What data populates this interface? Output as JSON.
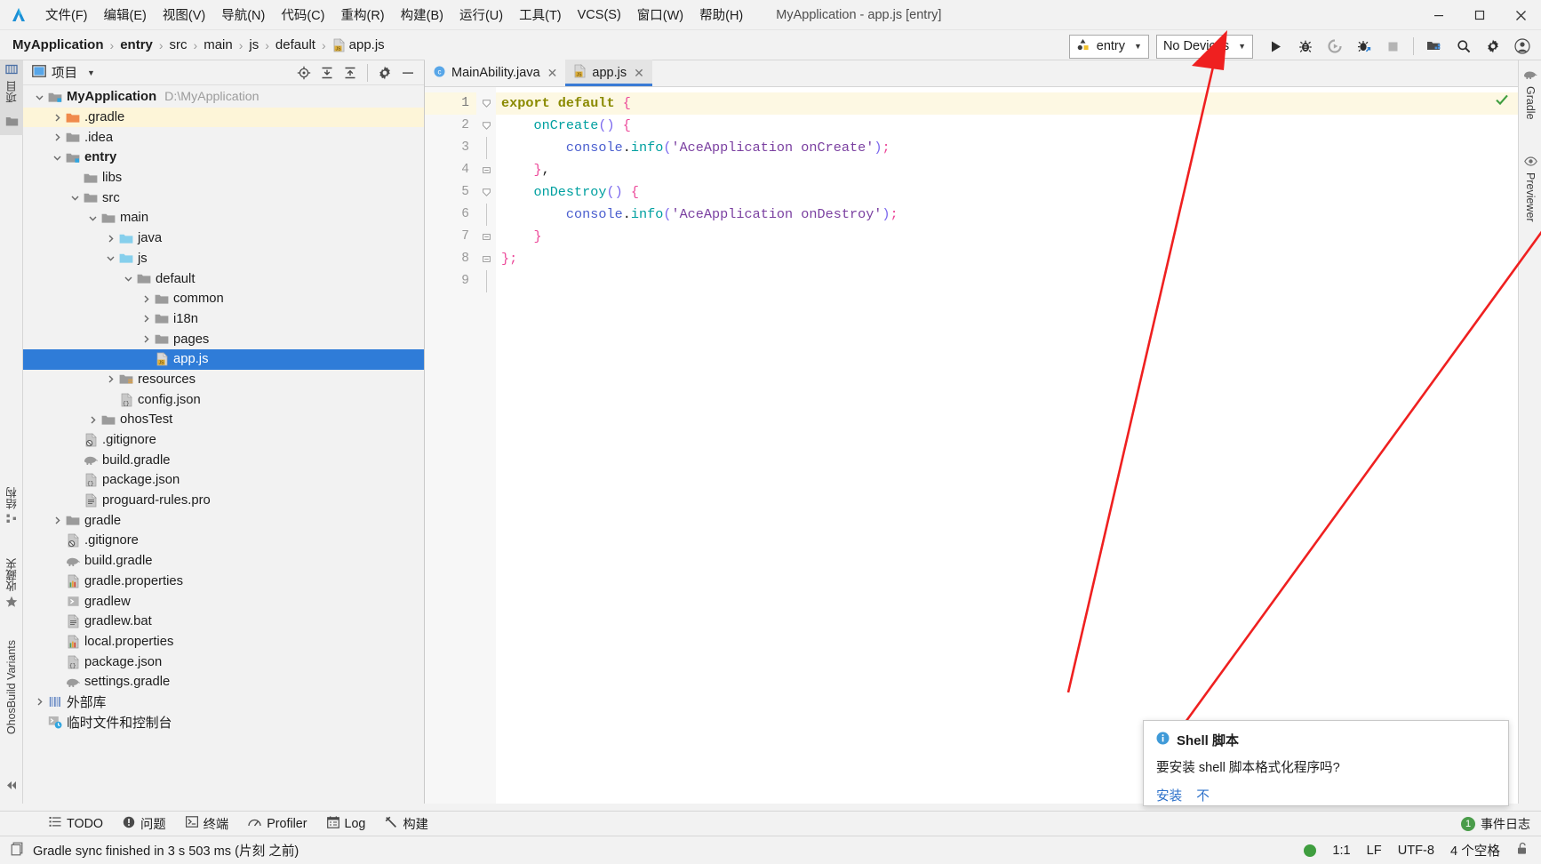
{
  "window": {
    "title": "MyApplication - app.js [entry]",
    "logo_icon": "deveco-logo-icon",
    "minimize_icon": "minimize-icon",
    "maximize_icon": "maximize-icon",
    "close_icon": "close-icon"
  },
  "menubar": {
    "items": [
      {
        "label": "文件(F)"
      },
      {
        "label": "编辑(E)"
      },
      {
        "label": "视图(V)"
      },
      {
        "label": "导航(N)"
      },
      {
        "label": "代码(C)"
      },
      {
        "label": "重构(R)"
      },
      {
        "label": "构建(B)"
      },
      {
        "label": "运行(U)"
      },
      {
        "label": "工具(T)"
      },
      {
        "label": "VCS(S)"
      },
      {
        "label": "窗口(W)"
      },
      {
        "label": "帮助(H)"
      }
    ]
  },
  "breadcrumb": {
    "items": [
      {
        "label": "MyApplication",
        "bold": true
      },
      {
        "label": "entry",
        "bold": true
      },
      {
        "label": "src",
        "bold": false
      },
      {
        "label": "main",
        "bold": false
      },
      {
        "label": "js",
        "bold": false
      },
      {
        "label": "default",
        "bold": false
      },
      {
        "label": "app.js",
        "bold": false,
        "icon": "js-file-icon"
      }
    ],
    "separator": "›"
  },
  "toolbar": {
    "module_selector": {
      "label": "entry",
      "icon": "module-icon",
      "caret": "▼"
    },
    "device_selector": {
      "label": "No Devices",
      "caret": "▼"
    },
    "buttons": [
      {
        "name": "run-button",
        "icon": "play-icon"
      },
      {
        "name": "debug-button",
        "icon": "bug-icon"
      },
      {
        "name": "attach-debugger-button",
        "icon": "attach-debug-icon",
        "disabled": true
      },
      {
        "name": "profile-button",
        "icon": "bug-profile-icon"
      },
      {
        "name": "stop-button",
        "icon": "stop-square-icon",
        "disabled": true
      },
      {
        "name": "project-structure-button",
        "icon": "project-structure-icon"
      },
      {
        "name": "search-everywhere-button",
        "icon": "search-icon"
      },
      {
        "name": "settings-button",
        "icon": "gear-icon"
      },
      {
        "name": "account-button",
        "icon": "account-icon"
      }
    ]
  },
  "left_rail": {
    "top": [
      {
        "label": "项目",
        "icon": "project-tool-icon",
        "active": true
      },
      {
        "label": "",
        "icon": "folder-icon",
        "active": false
      }
    ],
    "bottom": [
      {
        "label": "结构",
        "icon": "structure-icon"
      },
      {
        "label": "收藏夹",
        "icon": "star-icon"
      },
      {
        "label": "OhosBuild Variants",
        "icon": "variants-icon"
      }
    ],
    "collapse_icon": "collapse-all-icon"
  },
  "right_rail": {
    "items": [
      {
        "label": "Gradle",
        "icon": "gradle-elephant-icon"
      },
      {
        "label": "Previewer",
        "icon": "eye-icon"
      }
    ]
  },
  "project_panel": {
    "header": {
      "title": "项目",
      "title_icon": "project-window-icon",
      "dropdown_caret": "▼",
      "actions": [
        {
          "name": "locate-file-icon"
        },
        {
          "name": "expand-all-icon"
        },
        {
          "name": "collapse-all-icon"
        },
        {
          "name": "gear-icon"
        },
        {
          "name": "hide-icon"
        }
      ]
    },
    "tree": [
      {
        "depth": 0,
        "arrow": "down",
        "icon": "module-folder-icon",
        "label": "MyApplication",
        "bold": true,
        "path": "D:\\MyApplication",
        "state": "normal"
      },
      {
        "depth": 1,
        "arrow": "right",
        "icon": "folder-orange-icon",
        "label": ".gradle",
        "bold": false,
        "path": "",
        "state": "highlight"
      },
      {
        "depth": 1,
        "arrow": "right",
        "icon": "folder-icon",
        "label": ".idea",
        "bold": false,
        "path": "",
        "state": "normal"
      },
      {
        "depth": 1,
        "arrow": "down",
        "icon": "module-folder-icon",
        "label": "entry",
        "bold": true,
        "path": "",
        "state": "normal"
      },
      {
        "depth": 2,
        "arrow": "none",
        "icon": "folder-icon",
        "label": "libs",
        "bold": false,
        "path": "",
        "state": "normal"
      },
      {
        "depth": 2,
        "arrow": "down",
        "icon": "folder-icon",
        "label": "src",
        "bold": false,
        "path": "",
        "state": "normal"
      },
      {
        "depth": 3,
        "arrow": "down",
        "icon": "folder-icon",
        "label": "main",
        "bold": false,
        "path": "",
        "state": "normal"
      },
      {
        "depth": 4,
        "arrow": "right",
        "icon": "folder-blue-icon",
        "label": "java",
        "bold": false,
        "path": "",
        "state": "normal"
      },
      {
        "depth": 4,
        "arrow": "down",
        "icon": "folder-blue-icon",
        "label": "js",
        "bold": false,
        "path": "",
        "state": "normal"
      },
      {
        "depth": 5,
        "arrow": "down",
        "icon": "folder-icon",
        "label": "default",
        "bold": false,
        "path": "",
        "state": "normal"
      },
      {
        "depth": 6,
        "arrow": "right",
        "icon": "folder-icon",
        "label": "common",
        "bold": false,
        "path": "",
        "state": "normal"
      },
      {
        "depth": 6,
        "arrow": "right",
        "icon": "folder-icon",
        "label": "i18n",
        "bold": false,
        "path": "",
        "state": "normal"
      },
      {
        "depth": 6,
        "arrow": "right",
        "icon": "folder-icon",
        "label": "pages",
        "bold": false,
        "path": "",
        "state": "normal"
      },
      {
        "depth": 6,
        "arrow": "none",
        "icon": "js-file-icon",
        "label": "app.js",
        "bold": false,
        "path": "",
        "state": "selected"
      },
      {
        "depth": 4,
        "arrow": "right",
        "icon": "resources-folder-icon",
        "label": "resources",
        "bold": false,
        "path": "",
        "state": "normal"
      },
      {
        "depth": 4,
        "arrow": "none",
        "icon": "json-file-icon",
        "label": "config.json",
        "bold": false,
        "path": "",
        "state": "normal"
      },
      {
        "depth": 3,
        "arrow": "right",
        "icon": "folder-icon",
        "label": "ohosTest",
        "bold": false,
        "path": "",
        "state": "normal"
      },
      {
        "depth": 2,
        "arrow": "none",
        "icon": "gitignore-file-icon",
        "label": ".gitignore",
        "bold": false,
        "path": "",
        "state": "normal"
      },
      {
        "depth": 2,
        "arrow": "none",
        "icon": "gradle-file-icon",
        "label": "build.gradle",
        "bold": false,
        "path": "",
        "state": "normal"
      },
      {
        "depth": 2,
        "arrow": "none",
        "icon": "json-file-icon",
        "label": "package.json",
        "bold": false,
        "path": "",
        "state": "normal"
      },
      {
        "depth": 2,
        "arrow": "none",
        "icon": "text-file-icon",
        "label": "proguard-rules.pro",
        "bold": false,
        "path": "",
        "state": "normal"
      },
      {
        "depth": 1,
        "arrow": "right",
        "icon": "folder-icon",
        "label": "gradle",
        "bold": false,
        "path": "",
        "state": "normal"
      },
      {
        "depth": 1,
        "arrow": "none",
        "icon": "gitignore-file-icon",
        "label": ".gitignore",
        "bold": false,
        "path": "",
        "state": "normal"
      },
      {
        "depth": 1,
        "arrow": "none",
        "icon": "gradle-file-icon",
        "label": "build.gradle",
        "bold": false,
        "path": "",
        "state": "normal"
      },
      {
        "depth": 1,
        "arrow": "none",
        "icon": "properties-file-icon",
        "label": "gradle.properties",
        "bold": false,
        "path": "",
        "state": "normal"
      },
      {
        "depth": 1,
        "arrow": "none",
        "icon": "script-file-icon",
        "label": "gradlew",
        "bold": false,
        "path": "",
        "state": "normal"
      },
      {
        "depth": 1,
        "arrow": "none",
        "icon": "text-file-icon",
        "label": "gradlew.bat",
        "bold": false,
        "path": "",
        "state": "normal"
      },
      {
        "depth": 1,
        "arrow": "none",
        "icon": "properties-file-icon",
        "label": "local.properties",
        "bold": false,
        "path": "",
        "state": "normal"
      },
      {
        "depth": 1,
        "arrow": "none",
        "icon": "json-file-icon",
        "label": "package.json",
        "bold": false,
        "path": "",
        "state": "normal"
      },
      {
        "depth": 1,
        "arrow": "none",
        "icon": "gradle-file-icon",
        "label": "settings.gradle",
        "bold": false,
        "path": "",
        "state": "normal"
      },
      {
        "depth": 0,
        "arrow": "right",
        "icon": "library-icon",
        "label": "外部库",
        "bold": false,
        "path": "",
        "state": "normal"
      },
      {
        "depth": 0,
        "arrow": "none",
        "icon": "scratches-icon",
        "label": "临时文件和控制台",
        "bold": false,
        "path": "",
        "state": "normal"
      }
    ]
  },
  "editor": {
    "tabs": [
      {
        "label": "MainAbility.java",
        "icon": "java-class-icon",
        "active": false,
        "close": "✕"
      },
      {
        "label": "app.js",
        "icon": "js-file-icon",
        "active": true,
        "close": "✕"
      }
    ],
    "inspection_status_icon": "inspection-ok-icon",
    "line_numbers": [
      "1",
      "2",
      "3",
      "4",
      "5",
      "6",
      "7",
      "8",
      "9"
    ],
    "current_line": 1,
    "code_lines": [
      {
        "n": 1,
        "fold": "collapse",
        "tokens": [
          {
            "t": "export default ",
            "c": "k-kw"
          },
          {
            "t": "{",
            "c": "k-brace"
          }
        ]
      },
      {
        "n": 2,
        "fold": "collapse",
        "tokens": [
          {
            "t": "    ",
            "c": "k-punc"
          },
          {
            "t": "onCreate",
            "c": "k-fn"
          },
          {
            "t": "()",
            "c": "k-paren"
          },
          {
            "t": " ",
            "c": "k-punc"
          },
          {
            "t": "{",
            "c": "k-brace"
          }
        ]
      },
      {
        "n": 3,
        "fold": "none",
        "tokens": [
          {
            "t": "        ",
            "c": "k-punc"
          },
          {
            "t": "console",
            "c": "k-obj"
          },
          {
            "t": ".",
            "c": "k-punc"
          },
          {
            "t": "info",
            "c": "k-fn"
          },
          {
            "t": "(",
            "c": "k-paren"
          },
          {
            "t": "'AceApplication onCreate'",
            "c": "k-str"
          },
          {
            "t": ")",
            "c": "k-paren"
          },
          {
            "t": ";",
            "c": "k-semi"
          }
        ]
      },
      {
        "n": 4,
        "fold": "end",
        "tokens": [
          {
            "t": "    ",
            "c": "k-punc"
          },
          {
            "t": "}",
            "c": "k-brace"
          },
          {
            "t": ",",
            "c": "k-punc"
          }
        ]
      },
      {
        "n": 5,
        "fold": "collapse",
        "tokens": [
          {
            "t": "    ",
            "c": "k-punc"
          },
          {
            "t": "onDestroy",
            "c": "k-fn"
          },
          {
            "t": "()",
            "c": "k-paren"
          },
          {
            "t": " ",
            "c": "k-punc"
          },
          {
            "t": "{",
            "c": "k-brace"
          }
        ]
      },
      {
        "n": 6,
        "fold": "none",
        "tokens": [
          {
            "t": "        ",
            "c": "k-punc"
          },
          {
            "t": "console",
            "c": "k-obj"
          },
          {
            "t": ".",
            "c": "k-punc"
          },
          {
            "t": "info",
            "c": "k-fn"
          },
          {
            "t": "(",
            "c": "k-paren"
          },
          {
            "t": "'AceApplication onDestroy'",
            "c": "k-str"
          },
          {
            "t": ")",
            "c": "k-paren"
          },
          {
            "t": ";",
            "c": "k-semi"
          }
        ]
      },
      {
        "n": 7,
        "fold": "end",
        "tokens": [
          {
            "t": "    ",
            "c": "k-punc"
          },
          {
            "t": "}",
            "c": "k-brace"
          }
        ]
      },
      {
        "n": 8,
        "fold": "end",
        "tokens": [
          {
            "t": "}",
            "c": "k-brace"
          },
          {
            "t": ";",
            "c": "k-semi"
          }
        ]
      },
      {
        "n": 9,
        "fold": "none",
        "tokens": []
      }
    ]
  },
  "annotation": {
    "arrow_color": "#ef2020",
    "description": "red-arrow-pointing-to-device-selector"
  },
  "notification": {
    "icon": "info-icon",
    "title": "Shell 脚本",
    "message": "要安装 shell 脚本格式化程序吗?",
    "actions": [
      {
        "label": "安装"
      },
      {
        "label": "不"
      }
    ]
  },
  "bottom_toolwindows": {
    "items": [
      {
        "label": "TODO",
        "icon": "todo-icon"
      },
      {
        "label": "问题",
        "icon": "problems-icon"
      },
      {
        "label": "终端",
        "icon": "terminal-icon"
      },
      {
        "label": "Profiler",
        "icon": "profiler-icon"
      },
      {
        "label": "Log",
        "icon": "log-icon"
      },
      {
        "label": "构建",
        "icon": "build-hammer-icon"
      }
    ],
    "event_log": {
      "count": "1",
      "label": "事件日志"
    }
  },
  "statusbar": {
    "icon": "status-doc-icon",
    "message": "Gradle sync finished in 3 s 503 ms (片刻 之前)",
    "indicator_color": "#3f9e3f",
    "caret_position": "1:1",
    "line_separator": "LF",
    "encoding": "UTF-8",
    "indent": "4 个空格",
    "lock_icon": "unlock-icon"
  }
}
